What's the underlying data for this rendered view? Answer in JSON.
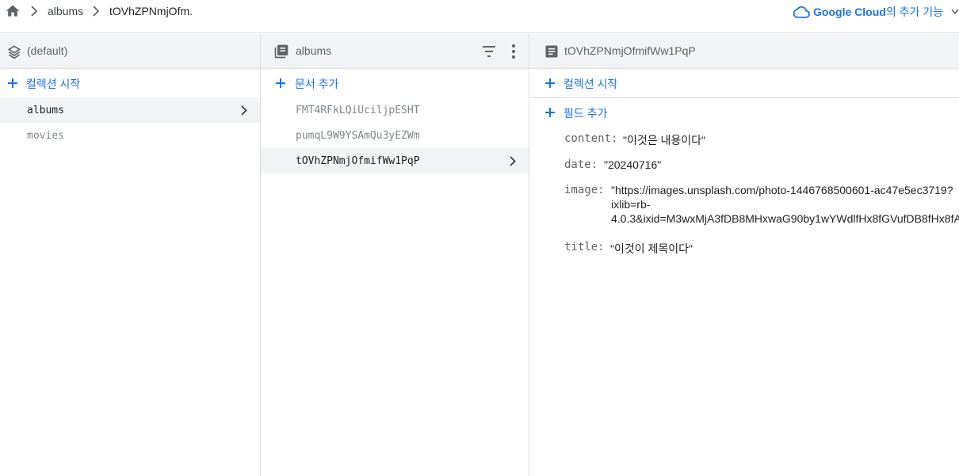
{
  "breadcrumb": {
    "items": [
      "albums",
      "tOVhZPNmjOfm."
    ]
  },
  "header_right": {
    "brand": "Google Cloud",
    "rest": "의 추가 기능"
  },
  "panel_root": {
    "title": "(default)",
    "add_label": "컬렉션 시작",
    "items": [
      "albums",
      "movies"
    ]
  },
  "panel_collection": {
    "title": "albums",
    "add_label": "문서 추가",
    "items": [
      "FMT4RFkLQiUciljpESHT",
      "pumqL9W9YSAmQu3yEZWm",
      "tOVhZPNmjOfmifWw1PqP"
    ]
  },
  "panel_document": {
    "title": "tOVhZPNmjOfmifWw1PqP",
    "add_collection_label": "컬렉션 시작",
    "add_field_label": "필드 추가",
    "fields": [
      {
        "key": "content:",
        "value": "\"이것은 내용이다\""
      },
      {
        "key": "date:",
        "value": "\"20240716\""
      },
      {
        "key": "image:",
        "lines": [
          "\"https://images.unsplash.com/photo-1446768500601-ac47e5ec3719?",
          "ixlib=rb-",
          "4.0.3&ixid=M3wxMjA3fDB8MHxwaG90by1wYWdlfHx8fGVufDB8fHx8fA"
        ]
      },
      {
        "key": "title:",
        "value": "\"이것이 제목이다\""
      }
    ]
  },
  "colors": {
    "accent": "#1a73e8",
    "header_bg": "#f1f3f4",
    "border": "#dadce0"
  }
}
